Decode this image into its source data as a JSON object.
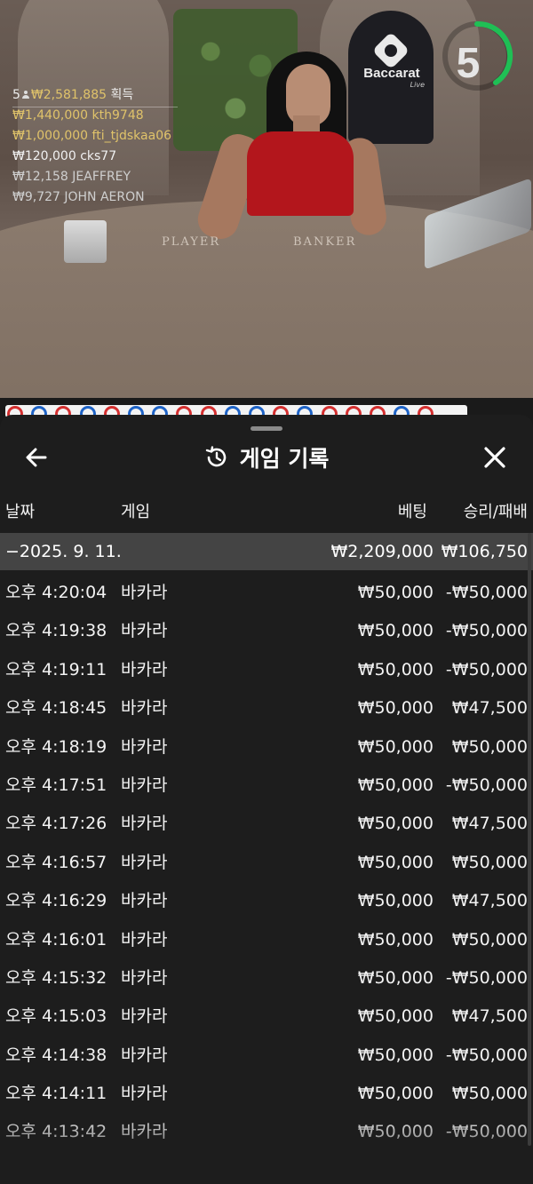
{
  "video": {
    "brand": "Baccarat",
    "brand_sub": "Live",
    "countdown": "5",
    "player_label": "PLAYER",
    "banker_label": "BANKER",
    "winners_header": {
      "count": "5",
      "amount": "₩2,581,885",
      "suffix": "획득"
    },
    "winners": [
      {
        "amount": "₩1,440,000",
        "name": "kth9748",
        "style": "gold"
      },
      {
        "amount": "₩1,000,000",
        "name": "fti_tjdskaa06",
        "style": "gold"
      },
      {
        "amount": "₩120,000",
        "name": "cks77",
        "style": "white"
      },
      {
        "amount": "₩12,158",
        "name": "JEAFFREY",
        "style": "grey"
      },
      {
        "amount": "₩9,727",
        "name": "JOHN AERON",
        "style": "grey"
      }
    ],
    "road_colors": [
      "#d32f2f",
      "#1e63c6",
      "#d32f2f",
      "#1e63c6",
      "#d32f2f",
      "#1e63c6",
      "#1e63c6",
      "#d32f2f",
      "#d32f2f",
      "#1e63c6",
      "#1e63c6",
      "#d32f2f",
      "#1e63c6",
      "#d32f2f",
      "#d32f2f",
      "#d32f2f",
      "#1e63c6",
      "#d32f2f"
    ]
  },
  "history": {
    "title": "게임 기록",
    "icons": {
      "back": "arrow-left-icon",
      "close": "close-icon",
      "title": "history-icon"
    },
    "columns": {
      "date": "날짜",
      "game": "게임",
      "bet": "베팅",
      "result": "승리/패배"
    },
    "date_group": {
      "date": "−2025. 9. 11.",
      "total_bet": "₩2,209,000",
      "total_result": "₩106,750"
    },
    "rows": [
      {
        "time": "오후 4:20:04",
        "game": "바카라",
        "bet": "₩50,000",
        "result": "-₩50,000"
      },
      {
        "time": "오후 4:19:38",
        "game": "바카라",
        "bet": "₩50,000",
        "result": "-₩50,000"
      },
      {
        "time": "오후 4:19:11",
        "game": "바카라",
        "bet": "₩50,000",
        "result": "-₩50,000"
      },
      {
        "time": "오후 4:18:45",
        "game": "바카라",
        "bet": "₩50,000",
        "result": "₩47,500"
      },
      {
        "time": "오후 4:18:19",
        "game": "바카라",
        "bet": "₩50,000",
        "result": "₩50,000"
      },
      {
        "time": "오후 4:17:51",
        "game": "바카라",
        "bet": "₩50,000",
        "result": "-₩50,000"
      },
      {
        "time": "오후 4:17:26",
        "game": "바카라",
        "bet": "₩50,000",
        "result": "₩47,500"
      },
      {
        "time": "오후 4:16:57",
        "game": "바카라",
        "bet": "₩50,000",
        "result": "₩50,000"
      },
      {
        "time": "오후 4:16:29",
        "game": "바카라",
        "bet": "₩50,000",
        "result": "₩47,500"
      },
      {
        "time": "오후 4:16:01",
        "game": "바카라",
        "bet": "₩50,000",
        "result": "₩50,000"
      },
      {
        "time": "오후 4:15:32",
        "game": "바카라",
        "bet": "₩50,000",
        "result": "-₩50,000"
      },
      {
        "time": "오후 4:15:03",
        "game": "바카라",
        "bet": "₩50,000",
        "result": "₩47,500"
      },
      {
        "time": "오후 4:14:38",
        "game": "바카라",
        "bet": "₩50,000",
        "result": "-₩50,000"
      },
      {
        "time": "오후 4:14:11",
        "game": "바카라",
        "bet": "₩50,000",
        "result": "₩50,000"
      },
      {
        "time": "오후 4:13:42",
        "game": "바카라",
        "bet": "₩50,000",
        "result": "-₩50,000"
      }
    ]
  }
}
